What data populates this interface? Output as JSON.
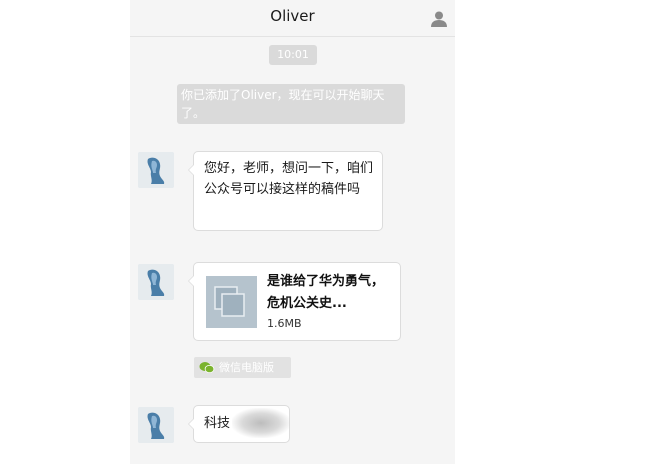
{
  "header": {
    "title": "Oliver",
    "icon": "user-profile-icon"
  },
  "timestamp": "10:01",
  "system_notice": "你已添加了Oliver，现在可以开始聊天了。",
  "messages": [
    {
      "type": "text",
      "text": "您好，老师，想问一下，咱们公众号可以接这样的稿件吗"
    },
    {
      "type": "file",
      "title": "是谁给了华为勇气，危机公关史...",
      "size": "1.6MB",
      "icon": "file-icon"
    },
    {
      "type": "text",
      "text": "科技"
    }
  ],
  "source_tag": {
    "label": "微信电脑版",
    "icon": "wechat-icon"
  },
  "colors": {
    "background": "#f5f5f5",
    "bubble": "#ffffff",
    "system_pill": "#dadada",
    "file_thumb": "#b5c3cd",
    "wechat_green": "#7bb32e"
  }
}
